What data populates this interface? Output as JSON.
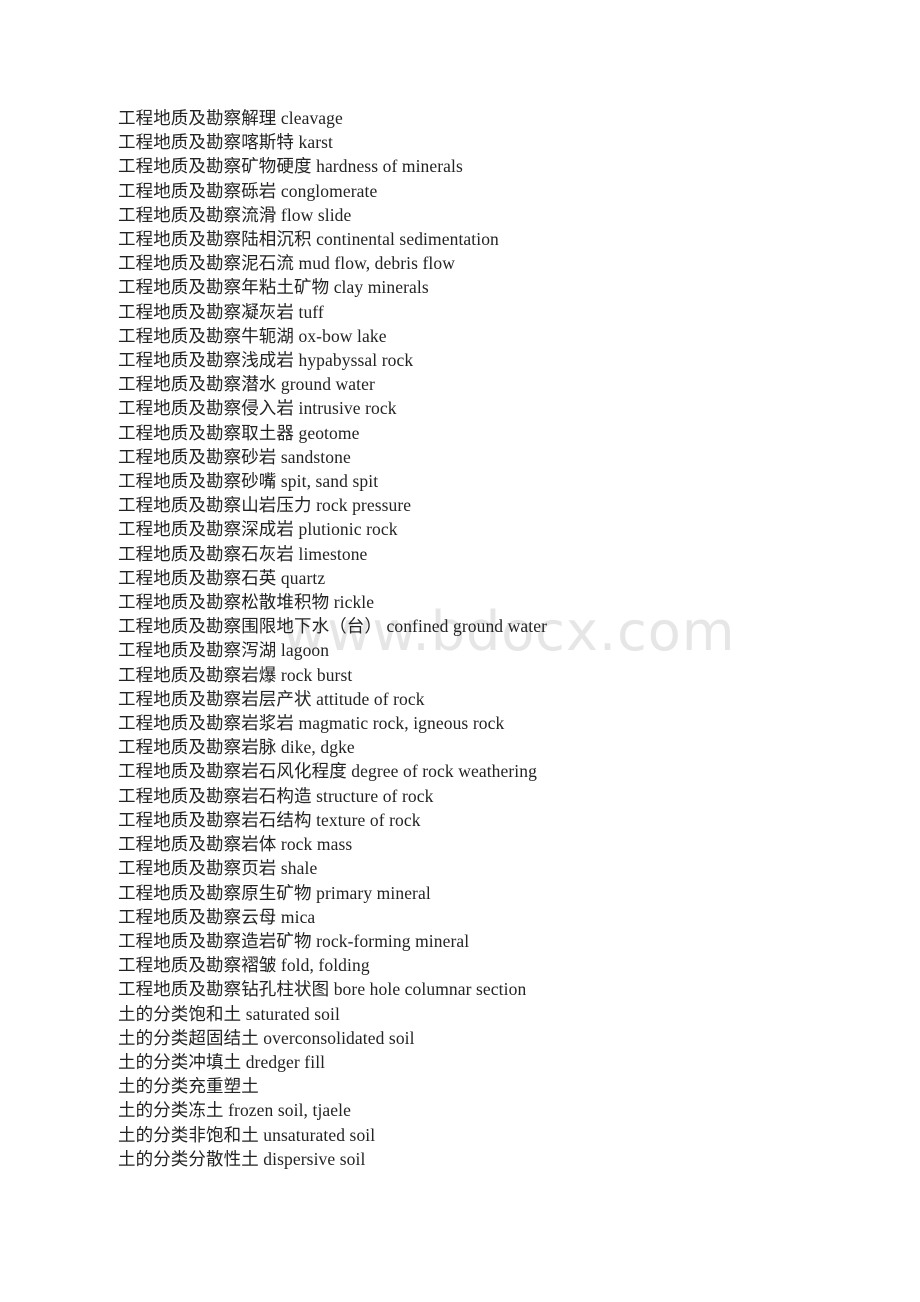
{
  "document": {
    "watermark": "www.bdocx.com",
    "text_color": "#232323",
    "watermark_color": "#e6e6e6",
    "background_color": "#ffffff"
  },
  "lines": [
    {
      "term": "工程地质及勘察解理",
      "translation": "cleavage"
    },
    {
      "term": "工程地质及勘察喀斯特",
      "translation": "karst"
    },
    {
      "term": "工程地质及勘察矿物硬度",
      "translation": "hardness of minerals"
    },
    {
      "term": "工程地质及勘察砾岩",
      "translation": "conglomerate"
    },
    {
      "term": "工程地质及勘察流滑",
      "translation": "flow slide"
    },
    {
      "term": "工程地质及勘察陆相沉积",
      "translation": "continental sedimentation"
    },
    {
      "term": "工程地质及勘察泥石流",
      "translation": "mud flow, debris flow"
    },
    {
      "term": "工程地质及勘察年粘土矿物",
      "translation": "clay minerals"
    },
    {
      "term": "工程地质及勘察凝灰岩",
      "translation": "tuff"
    },
    {
      "term": "工程地质及勘察牛轭湖",
      "translation": "ox-bow lake"
    },
    {
      "term": "工程地质及勘察浅成岩",
      "translation": "hypabyssal rock"
    },
    {
      "term": "工程地质及勘察潜水",
      "translation": "ground water"
    },
    {
      "term": "工程地质及勘察侵入岩",
      "translation": "intrusive rock"
    },
    {
      "term": "工程地质及勘察取土器",
      "translation": "geotome"
    },
    {
      "term": "工程地质及勘察砂岩",
      "translation": "sandstone"
    },
    {
      "term": "工程地质及勘察砂嘴",
      "translation": "spit, sand spit"
    },
    {
      "term": "工程地质及勘察山岩压力",
      "translation": "rock pressure"
    },
    {
      "term": "工程地质及勘察深成岩",
      "translation": "plutionic rock"
    },
    {
      "term": "工程地质及勘察石灰岩",
      "translation": "limestone"
    },
    {
      "term": "工程地质及勘察石英",
      "translation": "quartz"
    },
    {
      "term": "工程地质及勘察松散堆积物",
      "translation": "rickle"
    },
    {
      "term": "工程地质及勘察围限地下水（台）",
      "translation": "confined ground water"
    },
    {
      "term": "工程地质及勘察泻湖",
      "translation": "lagoon"
    },
    {
      "term": "工程地质及勘察岩爆",
      "translation": "rock burst"
    },
    {
      "term": "工程地质及勘察岩层产状",
      "translation": "attitude of rock"
    },
    {
      "term": "工程地质及勘察岩浆岩",
      "translation": "magmatic rock, igneous rock"
    },
    {
      "term": "工程地质及勘察岩脉",
      "translation": "dike, dgke"
    },
    {
      "term": "工程地质及勘察岩石风化程度",
      "translation": "degree of rock weathering"
    },
    {
      "term": "工程地质及勘察岩石构造",
      "translation": "structure of rock"
    },
    {
      "term": "工程地质及勘察岩石结构",
      "translation": "texture of rock"
    },
    {
      "term": "工程地质及勘察岩体",
      "translation": "rock mass"
    },
    {
      "term": "工程地质及勘察页岩",
      "translation": "shale"
    },
    {
      "term": "工程地质及勘察原生矿物",
      "translation": "primary mineral"
    },
    {
      "term": "工程地质及勘察云母",
      "translation": "mica"
    },
    {
      "term": "工程地质及勘察造岩矿物",
      "translation": "rock-forming mineral"
    },
    {
      "term": "工程地质及勘察褶皱",
      "translation": "fold, folding"
    },
    {
      "term": "工程地质及勘察钻孔柱状图",
      "translation": "bore hole columnar section"
    },
    {
      "term": "土的分类饱和土",
      "translation": "saturated soil"
    },
    {
      "term": "土的分类超固结土",
      "translation": "overconsolidated soil"
    },
    {
      "term": "土的分类冲填土",
      "translation": "dredger fill"
    },
    {
      "term": "土的分类充重塑土",
      "translation": ""
    },
    {
      "term": "土的分类冻土",
      "translation": "frozen soil, tjaele"
    },
    {
      "term": "土的分类非饱和土",
      "translation": "unsaturated soil"
    },
    {
      "term": "土的分类分散性土",
      "translation": "dispersive soil"
    }
  ]
}
